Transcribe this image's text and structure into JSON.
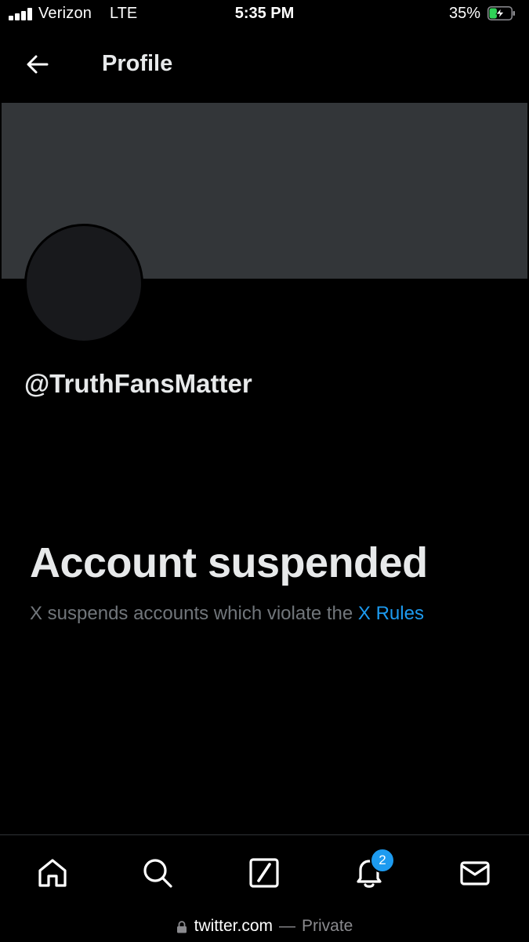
{
  "status_bar": {
    "carrier": "Verizon",
    "network": "LTE",
    "time": "5:35 PM",
    "battery_percent": "35%",
    "signal_icon": "cellular-signal-icon",
    "battery_icon": "battery-charging-icon",
    "battery_level": 0.35,
    "battery_color": "#30d158"
  },
  "header": {
    "title": "Profile",
    "back_icon": "arrow-left-icon"
  },
  "profile": {
    "handle": "@TruthFansMatter",
    "banner_color": "#333639",
    "avatar_color": "#18191c"
  },
  "suspension": {
    "title": "Account suspended",
    "description": "X suspends accounts which violate the ",
    "rules_link": "X Rules",
    "link_color": "#1d9bf0"
  },
  "bottom_nav": {
    "items": [
      {
        "icon": "home-icon"
      },
      {
        "icon": "search-icon"
      },
      {
        "icon": "compose-icon"
      },
      {
        "icon": "notifications-bell-icon",
        "badge": "2"
      },
      {
        "icon": "messages-envelope-icon"
      }
    ]
  },
  "browser": {
    "domain": "twitter.com",
    "separator": "—",
    "mode": "Private",
    "lock_icon": "lock-icon"
  }
}
